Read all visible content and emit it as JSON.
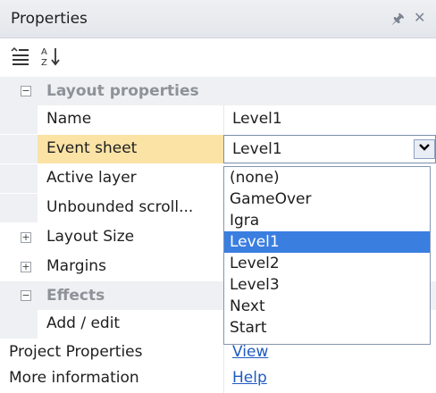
{
  "panel": {
    "title": "Properties",
    "pin_icon": "pin-icon",
    "close_icon": "close-icon"
  },
  "toolbar": {
    "categorized_icon": "categorized-icon",
    "alphabetical_icon": "sort-alphabetical-icon"
  },
  "sections": {
    "layout_properties": "Layout properties",
    "effects": "Effects"
  },
  "props": {
    "name": {
      "label": "Name",
      "value": "Level1"
    },
    "event_sheet": {
      "label": "Event sheet",
      "value": "Level1"
    },
    "active_layer": {
      "label": "Active layer"
    },
    "unbounded_scroll": {
      "label": "Unbounded scroll..."
    },
    "layout_size": {
      "label": "Layout Size"
    },
    "margins": {
      "label": "Margins"
    },
    "add_edit": {
      "label": "Add / edit"
    },
    "project_properties": {
      "label": "Project Properties",
      "link": "View"
    },
    "more_information": {
      "label": "More information",
      "link": "Help"
    }
  },
  "dropdown": {
    "options": [
      "(none)",
      "GameOver",
      "Igra",
      "Level1",
      "Level2",
      "Level3",
      "Next",
      "Start"
    ],
    "selected": "Level1"
  },
  "colors": {
    "selection_highlight": "#3a7ee0",
    "selected_row": "#fbe3a6",
    "link": "#1f5bc2"
  }
}
